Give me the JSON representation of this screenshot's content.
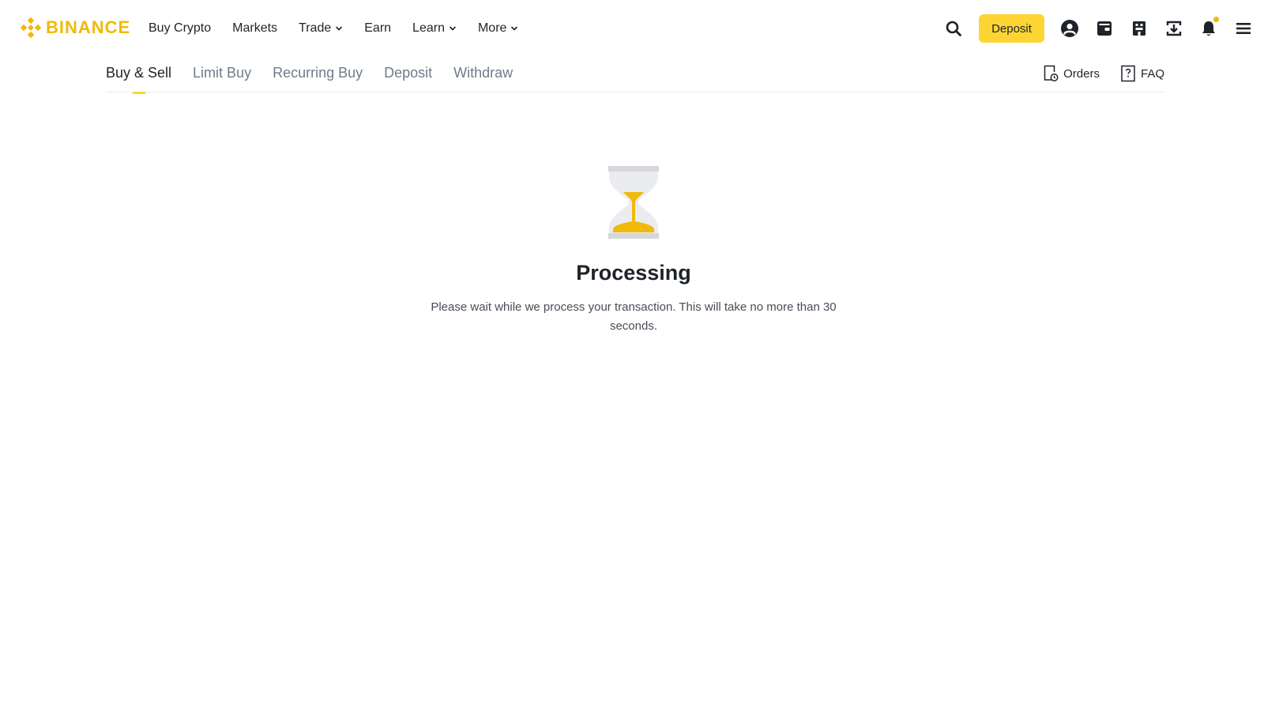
{
  "header": {
    "logo_text": "BINANCE",
    "nav": [
      {
        "label": "Buy Crypto",
        "dropdown": false
      },
      {
        "label": "Markets",
        "dropdown": false
      },
      {
        "label": "Trade",
        "dropdown": true
      },
      {
        "label": "Earn",
        "dropdown": false
      },
      {
        "label": "Learn",
        "dropdown": true
      },
      {
        "label": "More",
        "dropdown": true
      }
    ],
    "deposit_label": "Deposit",
    "icons": [
      "search-icon",
      "account-icon",
      "wallet-icon",
      "orders-building-icon",
      "download-icon",
      "bell-icon",
      "menu-icon"
    ]
  },
  "subnav": {
    "tabs": [
      "Buy & Sell",
      "Limit Buy",
      "Recurring Buy",
      "Deposit",
      "Withdraw"
    ],
    "active_tab": "Buy & Sell",
    "orders_label": "Orders",
    "faq_label": "FAQ"
  },
  "status": {
    "title": "Processing",
    "description": "Please wait while we process your transaction. This will take no more than 30 seconds."
  },
  "colors": {
    "brand": "#f0b90b",
    "button": "#fcd535",
    "text": "#1e2329",
    "muted": "#707a8a"
  }
}
